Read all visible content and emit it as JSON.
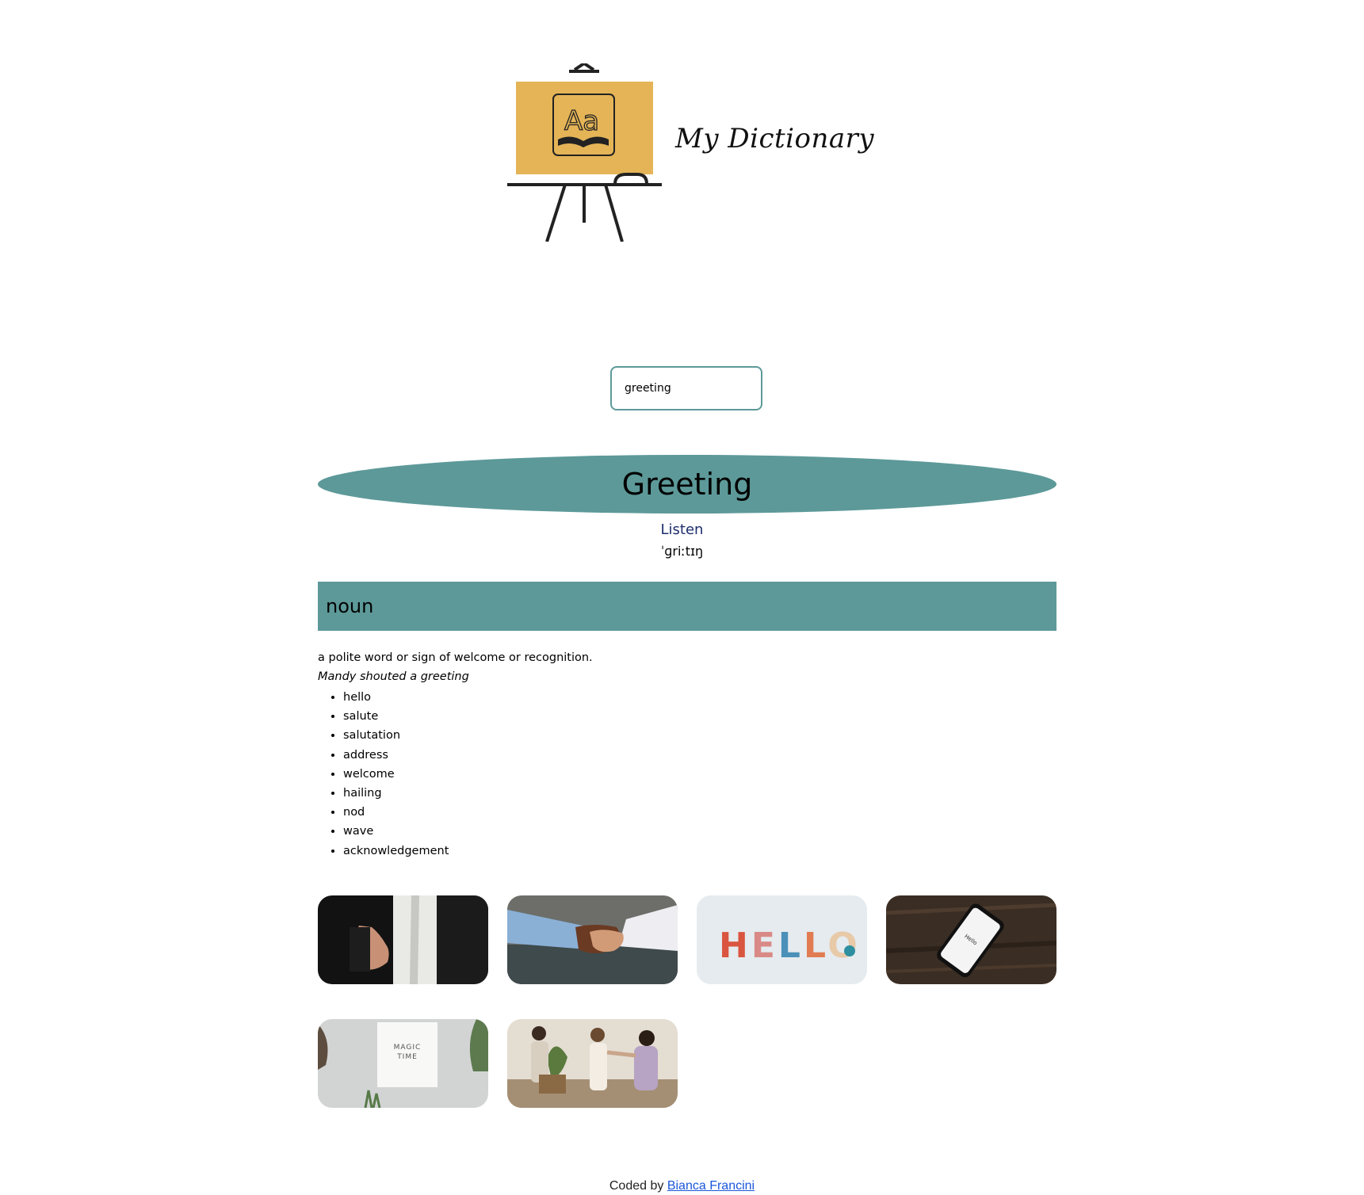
{
  "header": {
    "logo_icon": "dictionary-easel-icon",
    "title": "My Dictionary"
  },
  "search": {
    "value": "greeting"
  },
  "result": {
    "word": "Greeting",
    "listen_label": "Listen",
    "phonetic": "ˈɡriːtɪŋ",
    "meanings": [
      {
        "part_of_speech": "noun",
        "definition": "a polite word or sign of welcome or recognition.",
        "example": "Mandy shouted a greeting",
        "synonyms": [
          "hello",
          "salute",
          "salutation",
          "address",
          "welcome",
          "hailing",
          "nod",
          "wave",
          "acknowledgement"
        ]
      }
    ]
  },
  "photos": [
    {
      "subject": "hand-offered-for-handshake"
    },
    {
      "subject": "handshake"
    },
    {
      "subject": "hello-letters",
      "text": "HELLO"
    },
    {
      "subject": "smartphone-on-wood",
      "text": "Hello"
    },
    {
      "subject": "magic-time-card",
      "text": "MAGIC TIME"
    },
    {
      "subject": "women-greeting-with-plants"
    }
  ],
  "footer": {
    "prefix": "Coded by",
    "author": "Bianca Francini"
  },
  "colors": {
    "accent": "#5d9999",
    "logo_board": "#e4b457",
    "link": "#1a56db",
    "listen": "#1e2e6e"
  }
}
